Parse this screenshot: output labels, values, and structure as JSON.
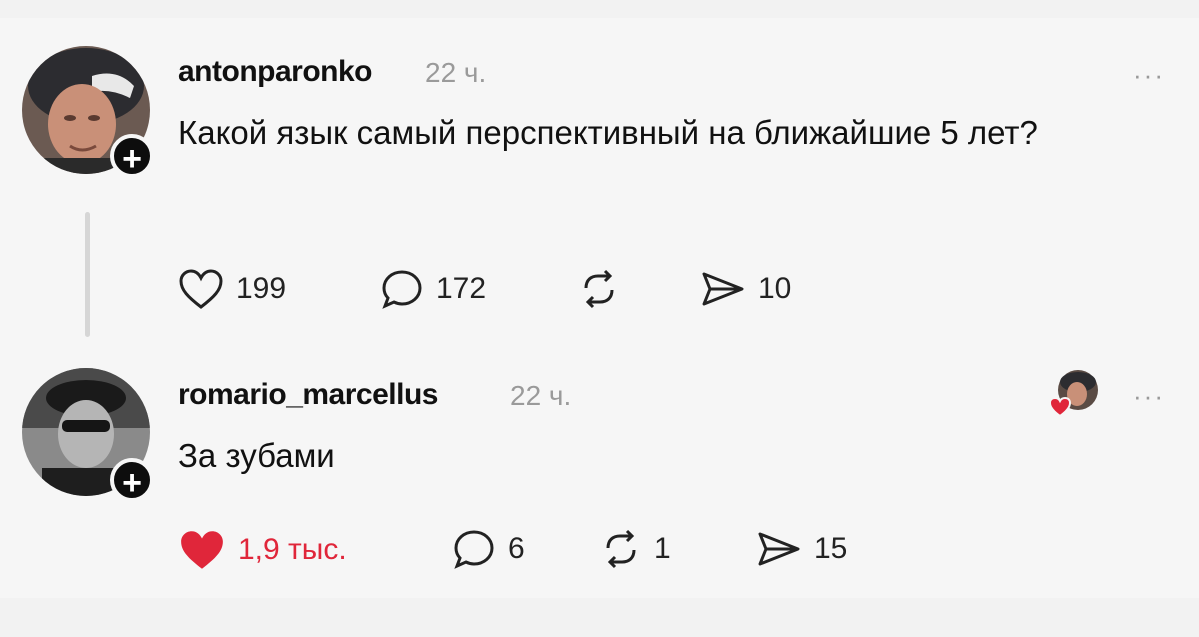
{
  "posts": [
    {
      "username": "antonparonko",
      "time": "22 ч.",
      "text": "Какой язык самый перспективный на ближайшие 5 лет?",
      "more": "···",
      "likes": "199",
      "comments": "172",
      "reposts": "",
      "shares": "10",
      "liked": false
    },
    {
      "username": "romario_marcellus",
      "time": "22 ч.",
      "text": "За зубами",
      "more": "···",
      "likes": "1,9 тыс.",
      "comments": "6",
      "reposts": "1",
      "shares": "15",
      "liked": true
    }
  ],
  "follow_label": "+",
  "colors": {
    "like_red": "#e0263a",
    "background": "#f6f6f6"
  }
}
